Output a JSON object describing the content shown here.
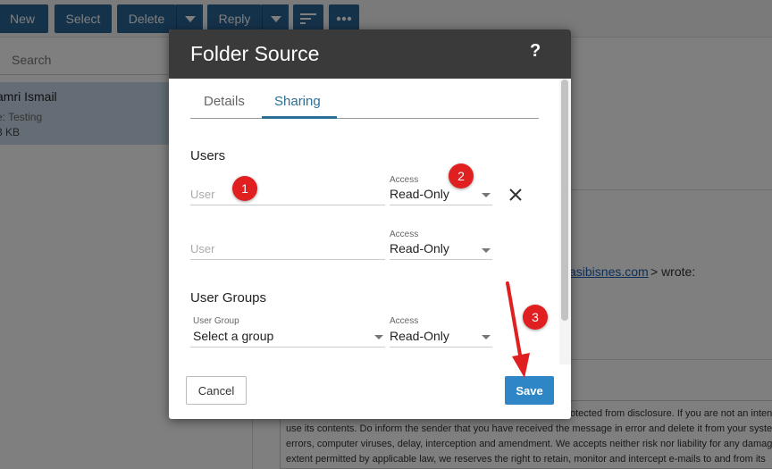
{
  "toolbar": {
    "new_label": "New",
    "select_label": "Select",
    "delete_label": "Delete",
    "reply_label": "Reply",
    "accent": "#2a6496"
  },
  "mail_list": {
    "search_placeholder": "Search",
    "item": {
      "from": "amri Ismail",
      "subject": "e: Testing",
      "size": "3 KB"
    }
  },
  "reading": {
    "link": "kasibisnes.com",
    "wrote": "> wrote:",
    "disclaimer": [
      "otected from disclosure. If you are not an inten",
      "use its contents. Do inform the sender that you have received the message in error and delete it from your syste",
      "errors, computer viruses, delay, interception and amendment. We accepts neither risk nor liability for any damag",
      "extent permitted by applicable law, we reserves the right to retain, monitor and intercept e-mails to and from its"
    ]
  },
  "dialog": {
    "title": "Folder Source",
    "help": "?",
    "tabs": [
      {
        "label": "Details",
        "active": false
      },
      {
        "label": "Sharing",
        "active": true
      }
    ],
    "users_title": "Users",
    "users": [
      {
        "user_placeholder": "User",
        "access_label": "Access",
        "access_value": "Read-Only",
        "removable": true
      },
      {
        "user_placeholder": "User",
        "access_label": "Access",
        "access_value": "Read-Only",
        "removable": false
      }
    ],
    "groups_title": "User Groups",
    "group": {
      "group_label": "User Group",
      "group_value": "Select a group",
      "access_label": "Access",
      "access_value": "Read-Only"
    },
    "cancel_label": "Cancel",
    "save_label": "Save",
    "save_color": "#2f86c6"
  },
  "annotations": {
    "badges": [
      "1",
      "2",
      "3"
    ],
    "color": "#e02020"
  }
}
